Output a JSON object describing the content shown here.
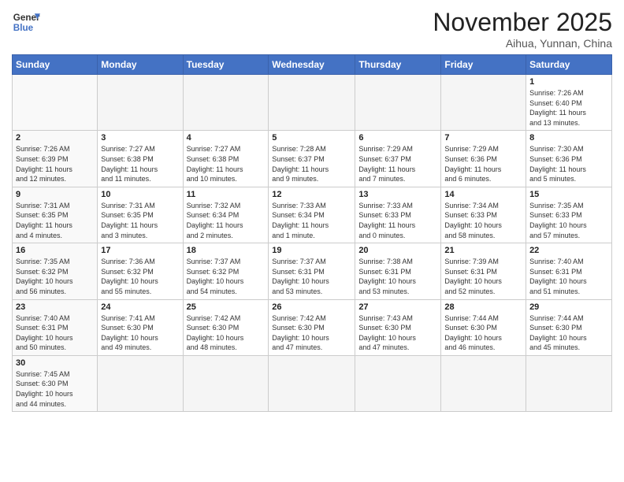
{
  "header": {
    "logo_general": "General",
    "logo_blue": "Blue",
    "month_title": "November 2025",
    "location": "Aihua, Yunnan, China"
  },
  "weekdays": [
    "Sunday",
    "Monday",
    "Tuesday",
    "Wednesday",
    "Thursday",
    "Friday",
    "Saturday"
  ],
  "days": [
    {
      "num": "",
      "info": ""
    },
    {
      "num": "",
      "info": ""
    },
    {
      "num": "",
      "info": ""
    },
    {
      "num": "",
      "info": ""
    },
    {
      "num": "",
      "info": ""
    },
    {
      "num": "",
      "info": ""
    },
    {
      "num": "1",
      "info": "Sunrise: 7:26 AM\nSunset: 6:40 PM\nDaylight: 11 hours\nand 13 minutes."
    },
    {
      "num": "2",
      "info": "Sunrise: 7:26 AM\nSunset: 6:39 PM\nDaylight: 11 hours\nand 12 minutes."
    },
    {
      "num": "3",
      "info": "Sunrise: 7:27 AM\nSunset: 6:38 PM\nDaylight: 11 hours\nand 11 minutes."
    },
    {
      "num": "4",
      "info": "Sunrise: 7:27 AM\nSunset: 6:38 PM\nDaylight: 11 hours\nand 10 minutes."
    },
    {
      "num": "5",
      "info": "Sunrise: 7:28 AM\nSunset: 6:37 PM\nDaylight: 11 hours\nand 9 minutes."
    },
    {
      "num": "6",
      "info": "Sunrise: 7:29 AM\nSunset: 6:37 PM\nDaylight: 11 hours\nand 7 minutes."
    },
    {
      "num": "7",
      "info": "Sunrise: 7:29 AM\nSunset: 6:36 PM\nDaylight: 11 hours\nand 6 minutes."
    },
    {
      "num": "8",
      "info": "Sunrise: 7:30 AM\nSunset: 6:36 PM\nDaylight: 11 hours\nand 5 minutes."
    },
    {
      "num": "9",
      "info": "Sunrise: 7:31 AM\nSunset: 6:35 PM\nDaylight: 11 hours\nand 4 minutes."
    },
    {
      "num": "10",
      "info": "Sunrise: 7:31 AM\nSunset: 6:35 PM\nDaylight: 11 hours\nand 3 minutes."
    },
    {
      "num": "11",
      "info": "Sunrise: 7:32 AM\nSunset: 6:34 PM\nDaylight: 11 hours\nand 2 minutes."
    },
    {
      "num": "12",
      "info": "Sunrise: 7:33 AM\nSunset: 6:34 PM\nDaylight: 11 hours\nand 1 minute."
    },
    {
      "num": "13",
      "info": "Sunrise: 7:33 AM\nSunset: 6:33 PM\nDaylight: 11 hours\nand 0 minutes."
    },
    {
      "num": "14",
      "info": "Sunrise: 7:34 AM\nSunset: 6:33 PM\nDaylight: 10 hours\nand 58 minutes."
    },
    {
      "num": "15",
      "info": "Sunrise: 7:35 AM\nSunset: 6:33 PM\nDaylight: 10 hours\nand 57 minutes."
    },
    {
      "num": "16",
      "info": "Sunrise: 7:35 AM\nSunset: 6:32 PM\nDaylight: 10 hours\nand 56 minutes."
    },
    {
      "num": "17",
      "info": "Sunrise: 7:36 AM\nSunset: 6:32 PM\nDaylight: 10 hours\nand 55 minutes."
    },
    {
      "num": "18",
      "info": "Sunrise: 7:37 AM\nSunset: 6:32 PM\nDaylight: 10 hours\nand 54 minutes."
    },
    {
      "num": "19",
      "info": "Sunrise: 7:37 AM\nSunset: 6:31 PM\nDaylight: 10 hours\nand 53 minutes."
    },
    {
      "num": "20",
      "info": "Sunrise: 7:38 AM\nSunset: 6:31 PM\nDaylight: 10 hours\nand 53 minutes."
    },
    {
      "num": "21",
      "info": "Sunrise: 7:39 AM\nSunset: 6:31 PM\nDaylight: 10 hours\nand 52 minutes."
    },
    {
      "num": "22",
      "info": "Sunrise: 7:40 AM\nSunset: 6:31 PM\nDaylight: 10 hours\nand 51 minutes."
    },
    {
      "num": "23",
      "info": "Sunrise: 7:40 AM\nSunset: 6:31 PM\nDaylight: 10 hours\nand 50 minutes."
    },
    {
      "num": "24",
      "info": "Sunrise: 7:41 AM\nSunset: 6:30 PM\nDaylight: 10 hours\nand 49 minutes."
    },
    {
      "num": "25",
      "info": "Sunrise: 7:42 AM\nSunset: 6:30 PM\nDaylight: 10 hours\nand 48 minutes."
    },
    {
      "num": "26",
      "info": "Sunrise: 7:42 AM\nSunset: 6:30 PM\nDaylight: 10 hours\nand 47 minutes."
    },
    {
      "num": "27",
      "info": "Sunrise: 7:43 AM\nSunset: 6:30 PM\nDaylight: 10 hours\nand 47 minutes."
    },
    {
      "num": "28",
      "info": "Sunrise: 7:44 AM\nSunset: 6:30 PM\nDaylight: 10 hours\nand 46 minutes."
    },
    {
      "num": "29",
      "info": "Sunrise: 7:44 AM\nSunset: 6:30 PM\nDaylight: 10 hours\nand 45 minutes."
    },
    {
      "num": "30",
      "info": "Sunrise: 7:45 AM\nSunset: 6:30 PM\nDaylight: 10 hours\nand 44 minutes."
    },
    {
      "num": "",
      "info": ""
    },
    {
      "num": "",
      "info": ""
    },
    {
      "num": "",
      "info": ""
    },
    {
      "num": "",
      "info": ""
    },
    {
      "num": "",
      "info": ""
    },
    {
      "num": "",
      "info": ""
    }
  ]
}
